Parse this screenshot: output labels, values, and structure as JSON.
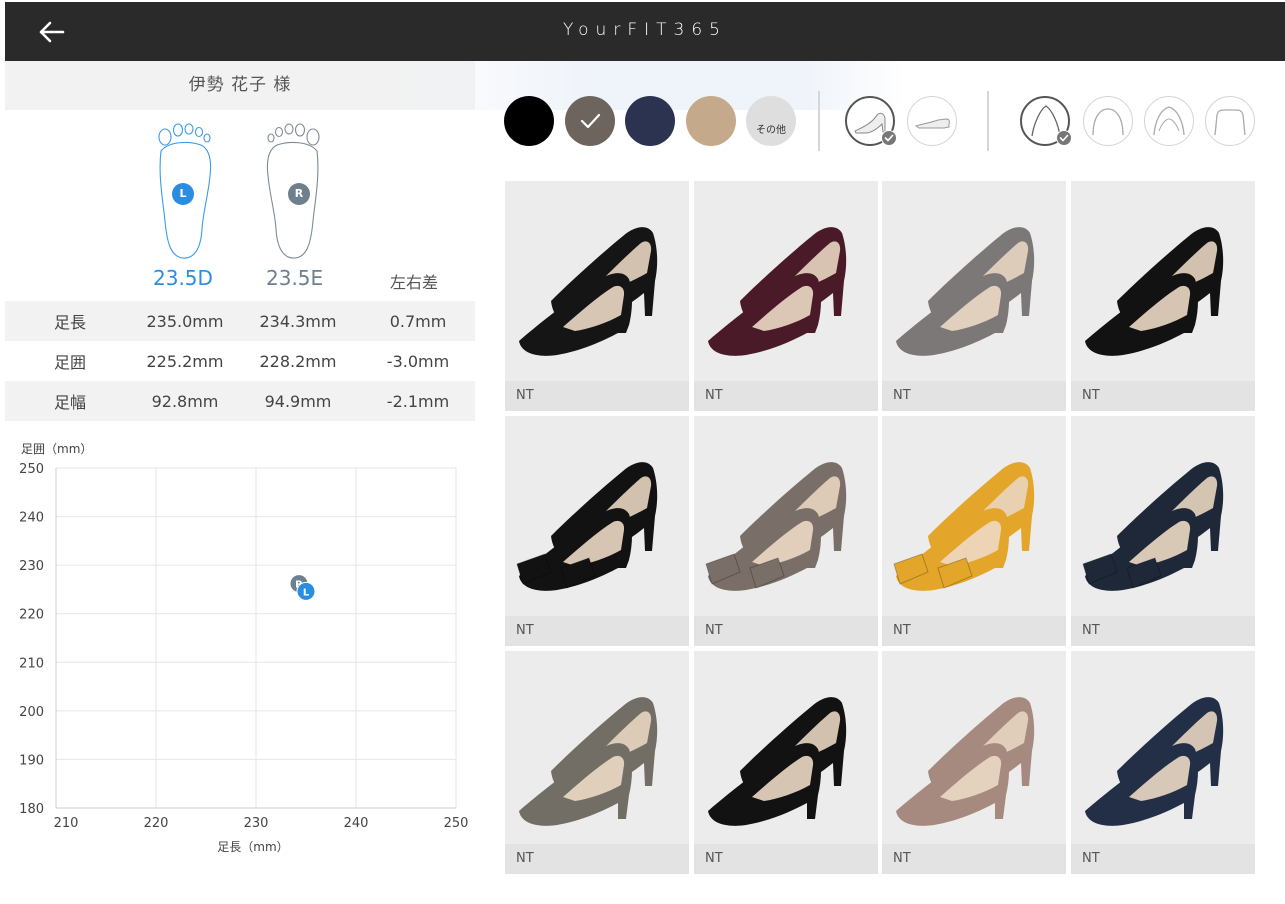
{
  "header": {
    "title": "YourFIT365",
    "back_icon": "arrow-left-icon"
  },
  "user": {
    "name": "伊勢 花子 様"
  },
  "feet": {
    "left": {
      "badge": "L",
      "size": "23.5D",
      "color": "#2b8de0"
    },
    "right": {
      "badge": "R",
      "size": "23.5E",
      "color": "#6e7f8d"
    },
    "diff_title": "左右差"
  },
  "measurements": [
    {
      "label": "足長",
      "left": "235.0mm",
      "right": "234.3mm",
      "diff": "0.7mm"
    },
    {
      "label": "足囲",
      "left": "225.2mm",
      "right": "228.2mm",
      "diff": "-3.0mm"
    },
    {
      "label": "足幅",
      "left": "92.8mm",
      "right": "94.9mm",
      "diff": "-2.1mm"
    }
  ],
  "chart_data": {
    "type": "scatter",
    "ylabel": "足囲（mm）",
    "xlabel": "足長（mm）",
    "xlim": [
      210,
      250
    ],
    "ylim": [
      180,
      250
    ],
    "xticks": [
      210,
      220,
      230,
      240,
      250
    ],
    "yticks": [
      250,
      240,
      230,
      220,
      210,
      200,
      190,
      180
    ],
    "grid": true,
    "series": [
      {
        "name": "R",
        "x": [
          234.3
        ],
        "y": [
          226.2
        ],
        "color": "#6e7f8d"
      },
      {
        "name": "L",
        "x": [
          235.0
        ],
        "y": [
          224.6
        ],
        "color": "#2b8de0"
      }
    ]
  },
  "filters": {
    "colors": [
      {
        "name": "black",
        "color": "#000000",
        "selected": false
      },
      {
        "name": "taupe",
        "color": "#6d655d",
        "selected": true
      },
      {
        "name": "navy",
        "color": "#2b3350",
        "selected": false
      },
      {
        "name": "beige",
        "color": "#c4a98b",
        "selected": false
      },
      {
        "name": "other",
        "color": "#dedede",
        "label": "その他",
        "selected": false
      }
    ],
    "heel_types": [
      {
        "name": "high-heel",
        "icon": "high-heel-icon",
        "selected": true
      },
      {
        "name": "flat",
        "icon": "flat-shoe-icon",
        "selected": false
      }
    ],
    "toe_shapes": [
      {
        "name": "pointed",
        "icon": "pointed-toe-icon",
        "selected": true
      },
      {
        "name": "round",
        "icon": "round-toe-icon",
        "selected": false
      },
      {
        "name": "almond",
        "icon": "almond-toe-icon",
        "selected": false
      },
      {
        "name": "square",
        "icon": "square-toe-icon",
        "selected": false
      }
    ]
  },
  "products": [
    {
      "label": "NT",
      "color": "#151515",
      "style": "plain"
    },
    {
      "label": "NT",
      "color": "#4b1a28",
      "style": "plain"
    },
    {
      "label": "NT",
      "color": "#7c7878",
      "style": "plain"
    },
    {
      "label": "NT",
      "color": "#121212",
      "style": "plain"
    },
    {
      "label": "NT",
      "color": "#121212",
      "style": "bow"
    },
    {
      "label": "NT",
      "color": "#7a6e69",
      "style": "bow"
    },
    {
      "label": "NT",
      "color": "#e3a62a",
      "style": "bow"
    },
    {
      "label": "NT",
      "color": "#1f2838",
      "style": "bow"
    },
    {
      "label": "NT",
      "color": "#726e66",
      "style": "low"
    },
    {
      "label": "NT",
      "color": "#121212",
      "style": "low"
    },
    {
      "label": "NT",
      "color": "#a68a80",
      "style": "low"
    },
    {
      "label": "NT",
      "color": "#232f47",
      "style": "low"
    }
  ]
}
